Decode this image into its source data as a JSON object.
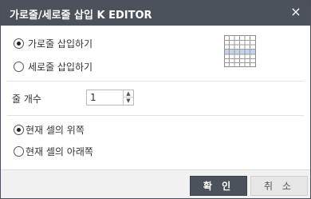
{
  "dialog": {
    "title": "가로줄/세로줄 삽입   K EDITOR",
    "close_symbol": "×"
  },
  "direction": {
    "options": [
      {
        "label": "가로줄 삽입하기",
        "checked": true
      },
      {
        "label": "세로줄 삽입하기",
        "checked": false
      }
    ],
    "preview_icon": "table-row-insert-icon"
  },
  "count": {
    "label": "줄 개수",
    "value": "1"
  },
  "position": {
    "options": [
      {
        "label": "현재 셀의 위쪽",
        "checked": true
      },
      {
        "label": "현재 셀의 아래쪽",
        "checked": false
      }
    ]
  },
  "buttons": {
    "ok": "확 인",
    "cancel": "취 소"
  },
  "colors": {
    "titlebar": "#4b525c",
    "ok_button": "#4b525c",
    "highlight_row": "#c4d3ec"
  }
}
